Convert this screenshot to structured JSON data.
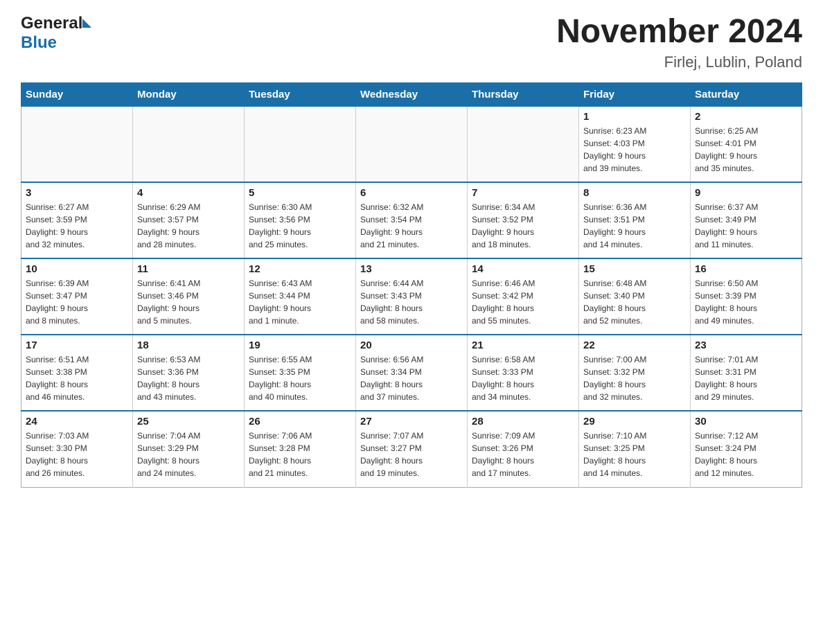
{
  "header": {
    "logo_general": "General",
    "logo_blue": "Blue",
    "month_title": "November 2024",
    "location": "Firlej, Lublin, Poland"
  },
  "days_of_week": [
    "Sunday",
    "Monday",
    "Tuesday",
    "Wednesday",
    "Thursday",
    "Friday",
    "Saturday"
  ],
  "weeks": [
    [
      {
        "num": "",
        "info": ""
      },
      {
        "num": "",
        "info": ""
      },
      {
        "num": "",
        "info": ""
      },
      {
        "num": "",
        "info": ""
      },
      {
        "num": "",
        "info": ""
      },
      {
        "num": "1",
        "info": "Sunrise: 6:23 AM\nSunset: 4:03 PM\nDaylight: 9 hours\nand 39 minutes."
      },
      {
        "num": "2",
        "info": "Sunrise: 6:25 AM\nSunset: 4:01 PM\nDaylight: 9 hours\nand 35 minutes."
      }
    ],
    [
      {
        "num": "3",
        "info": "Sunrise: 6:27 AM\nSunset: 3:59 PM\nDaylight: 9 hours\nand 32 minutes."
      },
      {
        "num": "4",
        "info": "Sunrise: 6:29 AM\nSunset: 3:57 PM\nDaylight: 9 hours\nand 28 minutes."
      },
      {
        "num": "5",
        "info": "Sunrise: 6:30 AM\nSunset: 3:56 PM\nDaylight: 9 hours\nand 25 minutes."
      },
      {
        "num": "6",
        "info": "Sunrise: 6:32 AM\nSunset: 3:54 PM\nDaylight: 9 hours\nand 21 minutes."
      },
      {
        "num": "7",
        "info": "Sunrise: 6:34 AM\nSunset: 3:52 PM\nDaylight: 9 hours\nand 18 minutes."
      },
      {
        "num": "8",
        "info": "Sunrise: 6:36 AM\nSunset: 3:51 PM\nDaylight: 9 hours\nand 14 minutes."
      },
      {
        "num": "9",
        "info": "Sunrise: 6:37 AM\nSunset: 3:49 PM\nDaylight: 9 hours\nand 11 minutes."
      }
    ],
    [
      {
        "num": "10",
        "info": "Sunrise: 6:39 AM\nSunset: 3:47 PM\nDaylight: 9 hours\nand 8 minutes."
      },
      {
        "num": "11",
        "info": "Sunrise: 6:41 AM\nSunset: 3:46 PM\nDaylight: 9 hours\nand 5 minutes."
      },
      {
        "num": "12",
        "info": "Sunrise: 6:43 AM\nSunset: 3:44 PM\nDaylight: 9 hours\nand 1 minute."
      },
      {
        "num": "13",
        "info": "Sunrise: 6:44 AM\nSunset: 3:43 PM\nDaylight: 8 hours\nand 58 minutes."
      },
      {
        "num": "14",
        "info": "Sunrise: 6:46 AM\nSunset: 3:42 PM\nDaylight: 8 hours\nand 55 minutes."
      },
      {
        "num": "15",
        "info": "Sunrise: 6:48 AM\nSunset: 3:40 PM\nDaylight: 8 hours\nand 52 minutes."
      },
      {
        "num": "16",
        "info": "Sunrise: 6:50 AM\nSunset: 3:39 PM\nDaylight: 8 hours\nand 49 minutes."
      }
    ],
    [
      {
        "num": "17",
        "info": "Sunrise: 6:51 AM\nSunset: 3:38 PM\nDaylight: 8 hours\nand 46 minutes."
      },
      {
        "num": "18",
        "info": "Sunrise: 6:53 AM\nSunset: 3:36 PM\nDaylight: 8 hours\nand 43 minutes."
      },
      {
        "num": "19",
        "info": "Sunrise: 6:55 AM\nSunset: 3:35 PM\nDaylight: 8 hours\nand 40 minutes."
      },
      {
        "num": "20",
        "info": "Sunrise: 6:56 AM\nSunset: 3:34 PM\nDaylight: 8 hours\nand 37 minutes."
      },
      {
        "num": "21",
        "info": "Sunrise: 6:58 AM\nSunset: 3:33 PM\nDaylight: 8 hours\nand 34 minutes."
      },
      {
        "num": "22",
        "info": "Sunrise: 7:00 AM\nSunset: 3:32 PM\nDaylight: 8 hours\nand 32 minutes."
      },
      {
        "num": "23",
        "info": "Sunrise: 7:01 AM\nSunset: 3:31 PM\nDaylight: 8 hours\nand 29 minutes."
      }
    ],
    [
      {
        "num": "24",
        "info": "Sunrise: 7:03 AM\nSunset: 3:30 PM\nDaylight: 8 hours\nand 26 minutes."
      },
      {
        "num": "25",
        "info": "Sunrise: 7:04 AM\nSunset: 3:29 PM\nDaylight: 8 hours\nand 24 minutes."
      },
      {
        "num": "26",
        "info": "Sunrise: 7:06 AM\nSunset: 3:28 PM\nDaylight: 8 hours\nand 21 minutes."
      },
      {
        "num": "27",
        "info": "Sunrise: 7:07 AM\nSunset: 3:27 PM\nDaylight: 8 hours\nand 19 minutes."
      },
      {
        "num": "28",
        "info": "Sunrise: 7:09 AM\nSunset: 3:26 PM\nDaylight: 8 hours\nand 17 minutes."
      },
      {
        "num": "29",
        "info": "Sunrise: 7:10 AM\nSunset: 3:25 PM\nDaylight: 8 hours\nand 14 minutes."
      },
      {
        "num": "30",
        "info": "Sunrise: 7:12 AM\nSunset: 3:24 PM\nDaylight: 8 hours\nand 12 minutes."
      }
    ]
  ]
}
